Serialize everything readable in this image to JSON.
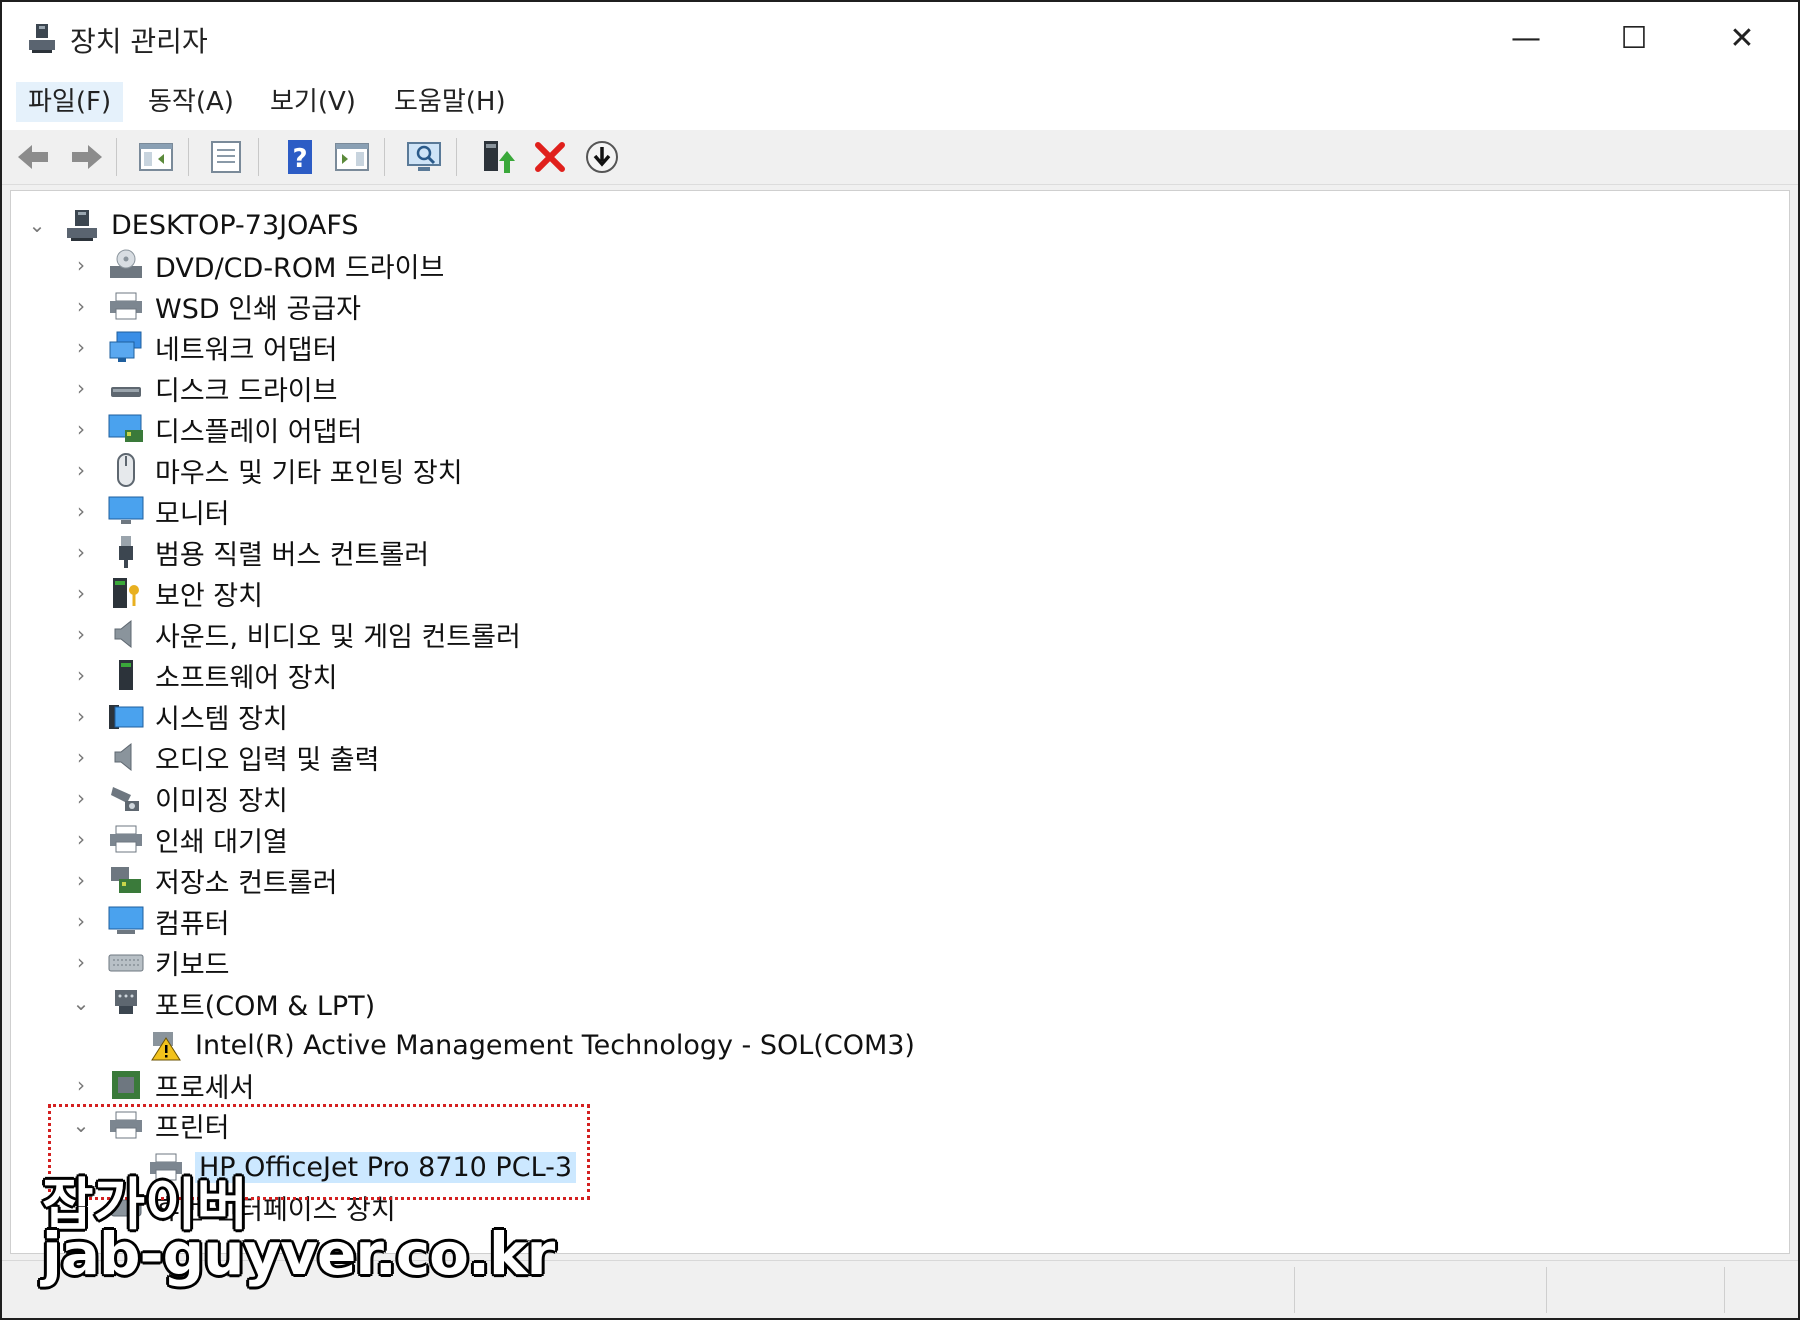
{
  "window": {
    "title": "장치 관리자",
    "controls": {
      "minimize": "—",
      "maximize": "☐",
      "close": "✕"
    }
  },
  "menu": {
    "items": [
      "파일(F)",
      "동작(A)",
      "보기(V)",
      "도움말(H)"
    ]
  },
  "toolbar": {
    "buttons": [
      "back-icon",
      "forward-icon",
      "show-hide-console-tree-icon",
      "properties-icon",
      "help-icon",
      "action-pane-icon",
      "scan-hardware-icon",
      "update-driver-icon",
      "uninstall-device-icon",
      "download-icon"
    ]
  },
  "tree": {
    "root": "DESKTOP-73JOAFS",
    "categories": [
      "DVD/CD-ROM 드라이브",
      "WSD 인쇄 공급자",
      "네트워크 어댑터",
      "디스크 드라이브",
      "디스플레이 어댑터",
      "마우스 및 기타 포인팅 장치",
      "모니터",
      "범용 직렬 버스 컨트롤러",
      "보안 장치",
      "사운드, 비디오 및 게임 컨트롤러",
      "소프트웨어 장치",
      "시스템 장치",
      "오디오 입력 및 출력",
      "이미징 장치",
      "인쇄 대기열",
      "저장소 컨트롤러",
      "컴퓨터",
      "키보드",
      "포트(COM & LPT)",
      "프로세서",
      "프린터",
      "휴먼 인터페이스 장치"
    ],
    "port_child": "Intel(R) Active Management Technology - SOL(COM3)",
    "printer_child": "HP OfficeJet Pro 8710 PCL-3"
  },
  "colors": {
    "selection": "#cce8ff",
    "highlight_box": "#d42020",
    "menu_active": "#e5f1fb"
  },
  "watermark": {
    "line1": "잡가이버",
    "line2": "jab-guyver.co.kr"
  }
}
